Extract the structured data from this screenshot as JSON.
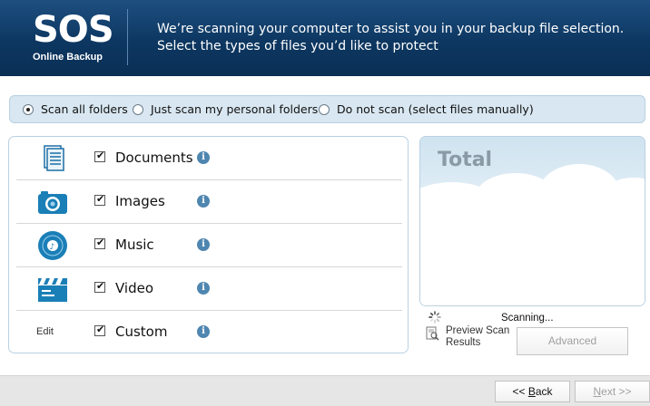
{
  "header": {
    "logo_main": "SOS",
    "logo_sub": "Online Backup",
    "message": "We’re scanning your computer to assist you in your backup file selection. Select the types of files you’d like to protect"
  },
  "scan_options": {
    "selected": "scan_all",
    "items": [
      {
        "id": "scan_all",
        "label": "Scan all folders",
        "checked": true
      },
      {
        "id": "personal",
        "label": "Just scan my personal folders",
        "checked": false
      },
      {
        "id": "none",
        "label": "Do not scan (select files manually)",
        "checked": false
      }
    ]
  },
  "file_types": [
    {
      "label": "Documents",
      "checked": true,
      "icon": "documents-icon"
    },
    {
      "label": "Images",
      "checked": true,
      "icon": "camera-icon"
    },
    {
      "label": "Music",
      "checked": true,
      "icon": "music-disc-icon"
    },
    {
      "label": "Video",
      "checked": true,
      "icon": "clapperboard-icon"
    },
    {
      "label": "Custom",
      "checked": true,
      "icon_text": "Edit"
    }
  ],
  "info_glyph": "i",
  "total": {
    "title": "Total"
  },
  "status": {
    "scanning": "Scanning..."
  },
  "preview": {
    "line1": "Preview Scan",
    "line2": "Results"
  },
  "buttons": {
    "advanced": "Advanced",
    "back_prefix": "<< ",
    "back_mnemonic": "B",
    "back_rest": "ack",
    "next_prefix": "",
    "next_mnemonic": "N",
    "next_rest": "ext >>"
  },
  "colors": {
    "header_bg": "#0d3761",
    "accent": "#1b7fb7",
    "info": "#4f86b0"
  }
}
